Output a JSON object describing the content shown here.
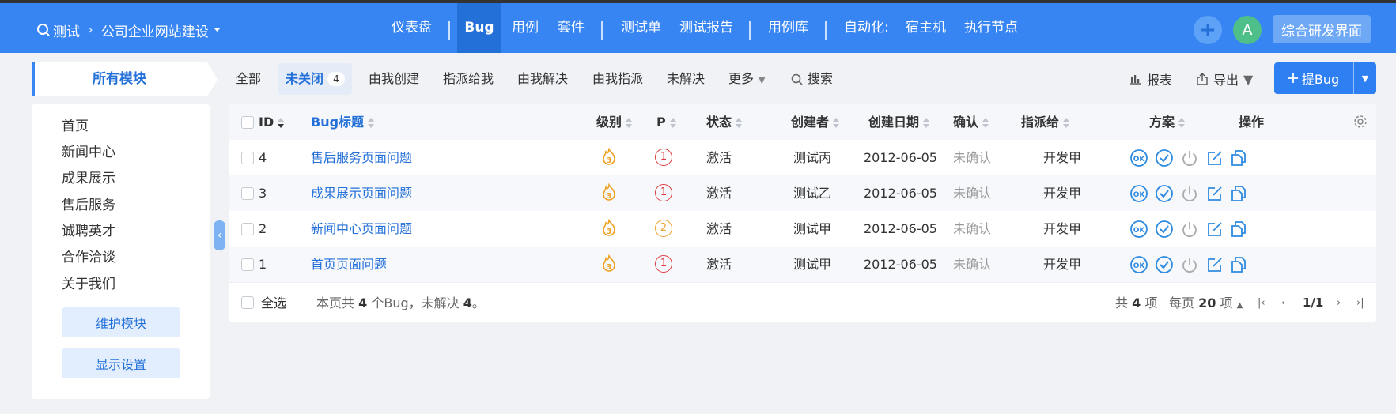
{
  "topbar": {
    "product": "测试",
    "project": "公司企业网站建设",
    "nav": [
      "仪表盘",
      "Bug",
      "用例",
      "套件",
      "测试单",
      "测试报告",
      "用例库"
    ],
    "automation_label": "自动化:",
    "automation_items": [
      "宿主机",
      "执行节点"
    ],
    "avatar_letter": "A",
    "workspace_button": "综合研发界面",
    "accent_color": "#3785f2"
  },
  "sidebar": {
    "title": "所有模块",
    "modules": [
      "首页",
      "新闻中心",
      "成果展示",
      "售后服务",
      "诚聘英才",
      "合作洽谈",
      "关于我们"
    ],
    "maintain_button": "维护模块",
    "display_button": "显示设置"
  },
  "filters": {
    "tabs": [
      "全部",
      "未关闭",
      "由我创建",
      "指派给我",
      "由我解决",
      "由我指派",
      "未解决",
      "更多"
    ],
    "active_tab": "未关闭",
    "active_count": "4",
    "search": "搜索",
    "report": "报表",
    "export": "导出",
    "add_bug": "提Bug"
  },
  "table": {
    "headers": [
      "ID",
      "Bug标题",
      "级别",
      "P",
      "状态",
      "创建者",
      "创建日期",
      "确认",
      "指派给",
      "方案",
      "操作"
    ],
    "rows": [
      {
        "id": "4",
        "title": "售后服务页面问题",
        "severity": "3",
        "pri": "1",
        "status": "激活",
        "creator": "测试丙",
        "date": "2012-06-05",
        "confirm": "未确认",
        "assignee": "开发甲",
        "resolution": ""
      },
      {
        "id": "3",
        "title": "成果展示页面问题",
        "severity": "3",
        "pri": "1",
        "status": "激活",
        "creator": "测试乙",
        "date": "2012-06-05",
        "confirm": "未确认",
        "assignee": "开发甲",
        "resolution": ""
      },
      {
        "id": "2",
        "title": "新闻中心页面问题",
        "severity": "3",
        "pri": "2",
        "status": "激活",
        "creator": "测试甲",
        "date": "2012-06-05",
        "confirm": "未确认",
        "assignee": "开发甲",
        "resolution": ""
      },
      {
        "id": "1",
        "title": "首页页面问题",
        "severity": "3",
        "pri": "1",
        "status": "激活",
        "creator": "测试甲",
        "date": "2012-06-05",
        "confirm": "未确认",
        "assignee": "开发甲",
        "resolution": ""
      }
    ],
    "actions": [
      "confirm-icon",
      "resolve-icon",
      "close-icon",
      "edit-icon",
      "copy-icon"
    ]
  },
  "footer": {
    "select_all": "全选",
    "summary_prefix": "本页共",
    "summary_total": "4",
    "summary_mid": "个Bug，未解决",
    "summary_unresolved": "4",
    "summary_suffix": "。",
    "total_prefix": "共",
    "total_count": "4",
    "total_suffix": "项",
    "per_page_prefix": "每页",
    "per_page": "20",
    "per_page_suffix": "项",
    "page": "1/1"
  }
}
